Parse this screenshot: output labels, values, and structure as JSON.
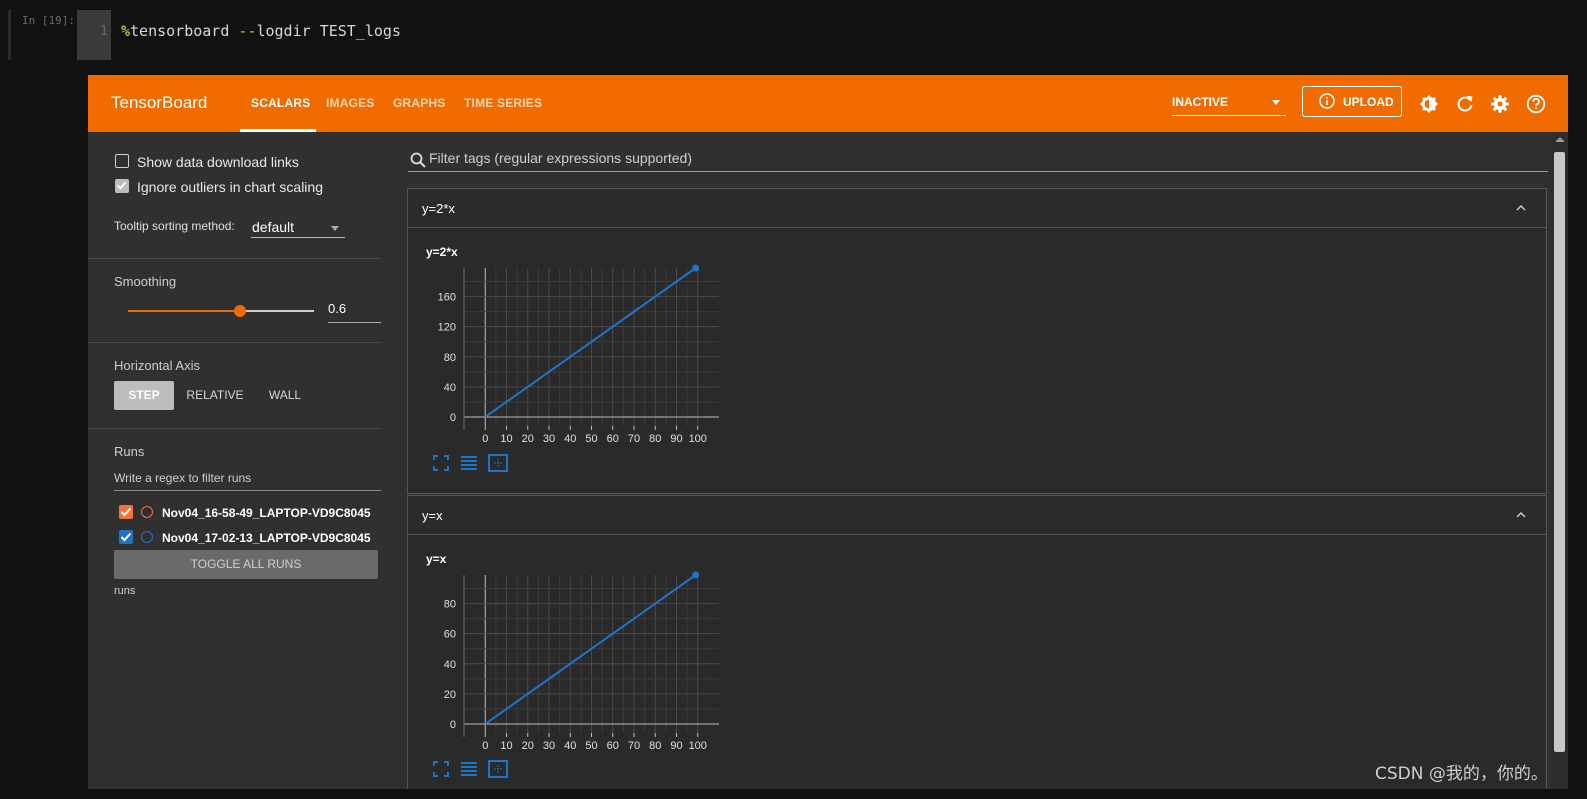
{
  "notebook": {
    "prompt": "In [19]:",
    "line_number": "1",
    "code_magic": "%",
    "code_cmd": "tensorboard ",
    "code_flag": "--",
    "code_rest": "logdir TEST_logs"
  },
  "header": {
    "brand": "TensorBoard",
    "tabs": [
      "SCALARS",
      "IMAGES",
      "GRAPHS",
      "TIME SERIES"
    ],
    "active_tab": "SCALARS",
    "status_select": "INACTIVE",
    "upload_label": "UPLOAD",
    "icons": [
      "theme-toggle-icon",
      "refresh-icon",
      "settings-icon",
      "help-icon"
    ],
    "color": "#f06c00"
  },
  "sidebar": {
    "show_download_links": "Show data download links",
    "show_download_checked": false,
    "ignore_outliers": "Ignore outliers in chart scaling",
    "ignore_outliers_checked": true,
    "tooltip_label": "Tooltip sorting method:",
    "tooltip_value": "default",
    "smoothing_label": "Smoothing",
    "smoothing_value": "0.6",
    "smoothing_fraction": 0.6,
    "horizontal_axis_label": "Horizontal Axis",
    "axis_options": [
      "STEP",
      "RELATIVE",
      "WALL"
    ],
    "axis_active": "STEP",
    "runs_label": "Runs",
    "runs_filter_placeholder": "Write a regex to filter runs",
    "runs": [
      {
        "name": "Nov04_16-58-49_LAPTOP-VD9C8045",
        "color": "#f4733d",
        "checked": true
      },
      {
        "name": "Nov04_17-02-13_LAPTOP-VD9C8045",
        "color": "#1f74c8",
        "checked": true
      }
    ],
    "toggle_all": "TOGGLE ALL RUNS",
    "runs_dir": "runs"
  },
  "main": {
    "filter_placeholder": "Filter tags (regular expressions supported)",
    "sections": [
      {
        "title": "y=2*x",
        "chart_title": "y=2*x"
      },
      {
        "title": "y=x",
        "chart_title": "y=x"
      }
    ]
  },
  "watermark": "CSDN @我的，你的。",
  "chart_data": [
    {
      "type": "line",
      "title": "y=2*x",
      "x": [
        0,
        99
      ],
      "series": [
        {
          "values": [
            0,
            198
          ]
        }
      ],
      "xticks": [
        "0",
        "10",
        "20",
        "30",
        "40",
        "50",
        "60",
        "70",
        "80",
        "90",
        "100"
      ],
      "yticks": [
        "0",
        "40",
        "80",
        "120",
        "160"
      ],
      "xlim": [
        -10,
        110
      ],
      "ylim": [
        -12,
        198
      ],
      "grid": true,
      "line_color": "#1f74c8"
    },
    {
      "type": "line",
      "title": "y=x",
      "x": [
        0,
        99
      ],
      "series": [
        {
          "values": [
            0,
            99
          ]
        }
      ],
      "xticks": [
        "0",
        "10",
        "20",
        "30",
        "40",
        "50",
        "60",
        "70",
        "80",
        "90",
        "100"
      ],
      "yticks": [
        "0",
        "20",
        "40",
        "60",
        "80"
      ],
      "xlim": [
        -10,
        110
      ],
      "ylim": [
        -6,
        99
      ],
      "grid": true,
      "line_color": "#1f74c8"
    }
  ]
}
